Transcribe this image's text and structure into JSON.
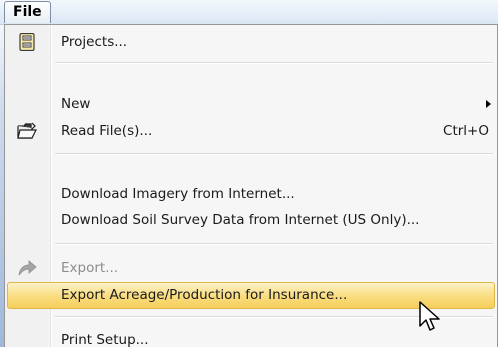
{
  "menubar": {
    "file_label": "File"
  },
  "menu": {
    "items": [
      {
        "label": "Projects...",
        "icon": "projects-icon"
      },
      {
        "label": "New",
        "submenu": true
      },
      {
        "label": "Read File(s)...",
        "shortcut": "Ctrl+O",
        "icon": "open-folder-icon"
      },
      {
        "label": "Download Imagery from Internet..."
      },
      {
        "label": "Download Soil Survey Data from Internet (US Only)..."
      },
      {
        "label": "Export...",
        "disabled": true,
        "icon": "export-arrow-icon"
      },
      {
        "label": "Export Acreage/Production for Insurance...",
        "highlighted": true
      },
      {
        "label": "Print Setup..."
      }
    ]
  },
  "colors": {
    "highlight_top": "#fdf2c8",
    "highlight_bottom": "#f6cf5d",
    "menu_background": "#f6f6f6",
    "menubar_background": "#dbe6f4"
  }
}
